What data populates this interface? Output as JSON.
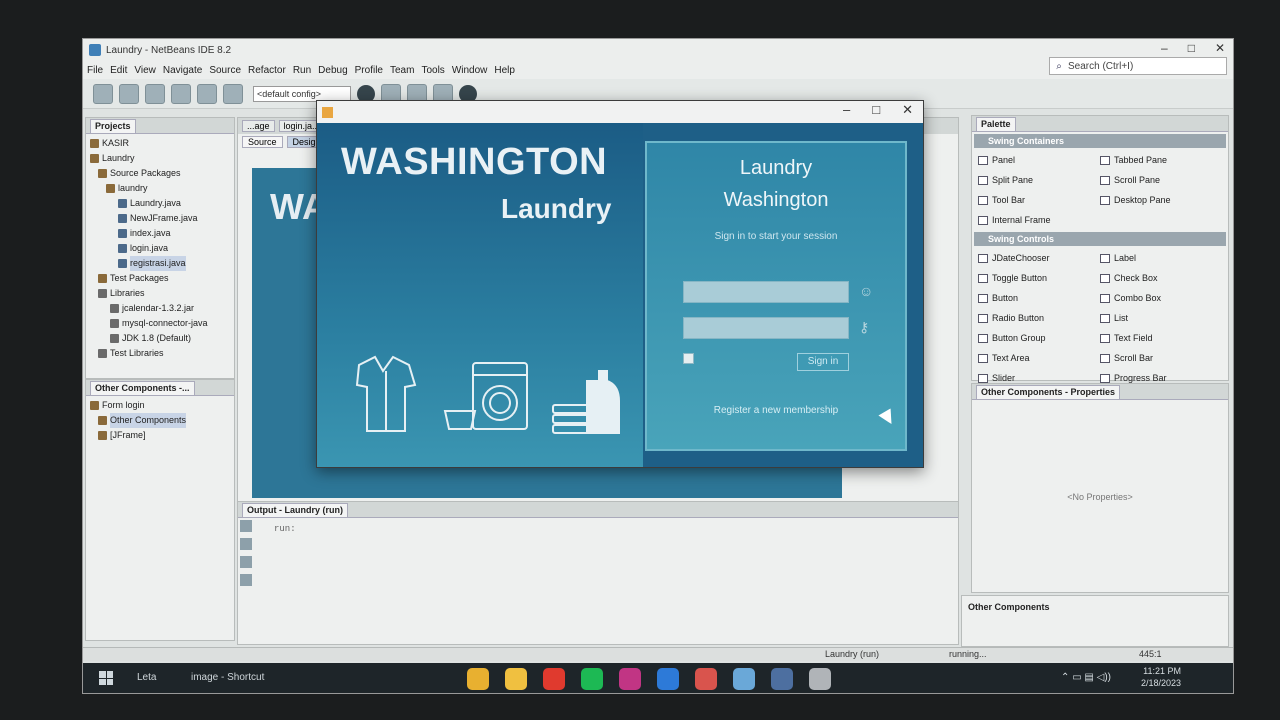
{
  "ide": {
    "title": "Laundry - NetBeans IDE 8.2",
    "menus": [
      "File",
      "Edit",
      "View",
      "Navigate",
      "Source",
      "Refactor",
      "Run",
      "Debug",
      "Profile",
      "Team",
      "Tools",
      "Window",
      "Help"
    ],
    "search_placeholder": "Search (Ctrl+I)",
    "config_select": "<default config>"
  },
  "projects": {
    "tab": "Projects",
    "nodes": [
      "KASIR",
      "Laundry",
      "Source Packages",
      "laundry",
      "Laundry.java",
      "NewJFrame.java",
      "index.java",
      "login.java",
      "registrasi.java",
      "Test Packages",
      "Libraries",
      "jcalendar-1.3.2.jar",
      "mysql-connector-java",
      "JDK 1.8 (Default)",
      "Test Libraries"
    ]
  },
  "navigator": {
    "tab": "Other Components -...",
    "nodes": [
      "Form login",
      "Other Components",
      "[JFrame]"
    ]
  },
  "editor": {
    "tabs": [
      "...age",
      "login.ja..."
    ],
    "modes": [
      "Source",
      "Design"
    ],
    "designer_text": "WA"
  },
  "palette": {
    "tab": "Palette",
    "sections": [
      {
        "name": "Swing Containers",
        "items": [
          "Panel",
          "Tabbed Pane",
          "Split Pane",
          "Scroll Pane",
          "Tool Bar",
          "Desktop Pane",
          "Internal Frame",
          ""
        ]
      },
      {
        "name": "Swing Controls",
        "items": [
          "JDateChooser",
          "Label",
          "Toggle Button",
          "Check Box",
          "Button",
          "Combo Box",
          "Radio Button",
          "List",
          "Button Group",
          "Text Field",
          "Text Area",
          "Scroll Bar",
          "Slider",
          "Progress Bar"
        ]
      }
    ]
  },
  "properties": {
    "tab": "Other Components - Properties",
    "empty": "<No Properties>",
    "footer": "Other Components"
  },
  "output": {
    "tab": "Output - Laundry (run)",
    "text": "run:"
  },
  "status": {
    "project": "Laundry (run)",
    "state": "running...",
    "pos": "445:1"
  },
  "taskbar": {
    "search": "Leta",
    "shortcut": "image - Shortcut",
    "time": "11:21 PM",
    "date": "2/18/2023",
    "app_colors": [
      "#e8b030",
      "#f0c040",
      "#e03a2e",
      "#1db954",
      "#c13584",
      "#2d7ad8",
      "#d9544d",
      "#6aa8d8",
      "#4d6fa0",
      "#b0b4b8"
    ]
  },
  "login": {
    "brand_line1": "WASHINGTON",
    "brand_line2": "Laundry",
    "panel_title1": "Laundry",
    "panel_title2": "Washington",
    "subtitle": "Sign in to start your session",
    "signin": "Sign in",
    "register": "Register a new membership"
  }
}
